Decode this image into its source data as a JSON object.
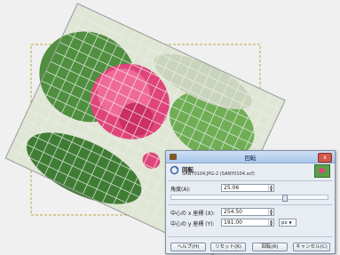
{
  "dialog": {
    "window_title": "回転",
    "heading": "回転",
    "subheading": "SANY0104.JPG-2 (SANY0104.xcf)",
    "angle": {
      "label": "角度(A):",
      "value": "25.06"
    },
    "center_x": {
      "label": "中心の x 座標 (X):",
      "value": "254.50"
    },
    "center_y": {
      "label": "中心の y 座標 (Y):",
      "value": "191.00"
    },
    "unit": "px",
    "buttons": {
      "help": "ヘルプ(H)",
      "reset": "リセット(R)",
      "rotate": "回転(R)",
      "cancel": "キャンセル(C)"
    },
    "close_glyph": "x"
  },
  "colors": {
    "canvas_bg": "#f0f0f0",
    "selection": "#d4c44a",
    "grid": "#e8e8e8",
    "flower": "#e0457a",
    "leaf": "#4f8f3f"
  },
  "angle_degrees": 25.06
}
